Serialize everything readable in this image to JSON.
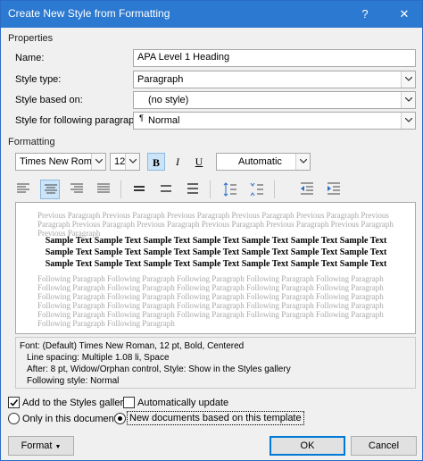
{
  "window": {
    "title": "Create New Style from Formatting",
    "help_label": "?",
    "close_label": "✕"
  },
  "properties": {
    "section_label": "Properties",
    "name_label": "Name:",
    "name_value": "APA Level 1 Heading",
    "style_type_label": "Style type:",
    "style_type_value": "Paragraph",
    "based_on_label": "Style based on:",
    "based_on_value": "(no style)",
    "following_label": "Style for following paragraph:",
    "following_icon": "¶",
    "following_value": "Normal"
  },
  "formatting": {
    "section_label": "Formatting",
    "font_name": "Times New Roman",
    "font_size": "12",
    "bold_label": "B",
    "italic_label": "I",
    "underline_label": "U",
    "color_value": "Automatic",
    "bold_active": true,
    "align_active": "center"
  },
  "preview": {
    "previous_text": "Previous Paragraph Previous Paragraph Previous Paragraph Previous Paragraph Previous Paragraph Previous Paragraph Previous Paragraph Previous Paragraph Previous Paragraph Previous Paragraph Previous Paragraph Previous Paragraph",
    "sample_text": "Sample Text Sample Text Sample Text Sample Text Sample Text Sample Text Sample Text Sample Text Sample Text Sample Text Sample Text Sample Text Sample Text Sample Text Sample Text Sample Text Sample Text Sample Text Sample Text Sample Text Sample Text",
    "following_text": "Following Paragraph Following Paragraph Following Paragraph Following Paragraph Following Paragraph Following Paragraph Following Paragraph Following Paragraph Following Paragraph Following Paragraph Following Paragraph Following Paragraph Following Paragraph Following Paragraph Following Paragraph Following Paragraph Following Paragraph Following Paragraph Following Paragraph Following Paragraph Following Paragraph Following Paragraph Following Paragraph Following Paragraph Following Paragraph Following Paragraph Following Paragraph"
  },
  "description": {
    "line1": "Font: (Default) Times New Roman, 12 pt, Bold, Centered",
    "line2": "Line spacing:  Multiple 1.08 li, Space",
    "line3": "After:  8 pt, Widow/Orphan control, Style: Show in the Styles gallery",
    "line4": "Following style: Normal"
  },
  "options": {
    "add_gallery_label": "Add to the Styles gallery",
    "add_gallery_checked": true,
    "auto_update_label": "Automatically update",
    "auto_update_checked": false,
    "only_doc_label": "Only in this document",
    "new_docs_label": "New documents based on this template",
    "selected_scope": "new-documents"
  },
  "buttons": {
    "format_label": "Format",
    "ok_label": "OK",
    "cancel_label": "Cancel"
  },
  "colors": {
    "titlebar": "#2b79d0",
    "accent": "#0078d7"
  }
}
